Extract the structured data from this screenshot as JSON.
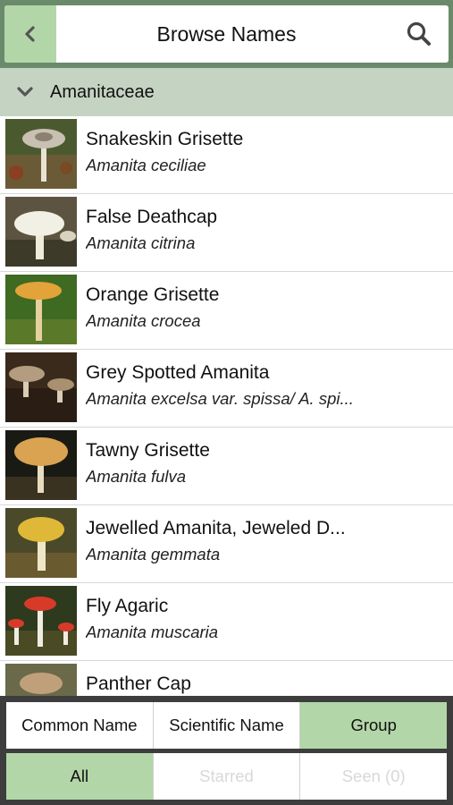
{
  "header": {
    "title": "Browse Names",
    "back_icon": "chevron-left-icon",
    "search_icon": "search-icon"
  },
  "group": {
    "label": "Amanitaceae",
    "icon": "chevron-down-icon"
  },
  "list": [
    {
      "common": "Snakeskin Grisette",
      "scientific": "Amanita ceciliae"
    },
    {
      "common": "False Deathcap",
      "scientific": "Amanita citrina"
    },
    {
      "common": "Orange Grisette",
      "scientific": "Amanita crocea"
    },
    {
      "common": "Grey Spotted Amanita",
      "scientific": "Amanita excelsa var. spissa/ A. spi..."
    },
    {
      "common": "Tawny Grisette",
      "scientific": "Amanita fulva"
    },
    {
      "common": "Jewelled Amanita, Jeweled D...",
      "scientific": "Amanita gemmata"
    },
    {
      "common": "Fly Agaric",
      "scientific": "Amanita muscaria"
    },
    {
      "common": "Panther Cap",
      "scientific": ""
    }
  ],
  "sort_tabs": [
    {
      "label": "Common Name",
      "active": false
    },
    {
      "label": "Scientific Name",
      "active": false
    },
    {
      "label": "Group",
      "active": true
    }
  ],
  "filter_tabs": [
    {
      "label": "All",
      "active": true
    },
    {
      "label": "Starred",
      "active": false
    },
    {
      "label": "Seen (0)",
      "active": false
    }
  ],
  "colors": {
    "accent_green": "#b3d6a8",
    "header_green": "#6b8a6b",
    "group_header": "#c5d3c2"
  }
}
